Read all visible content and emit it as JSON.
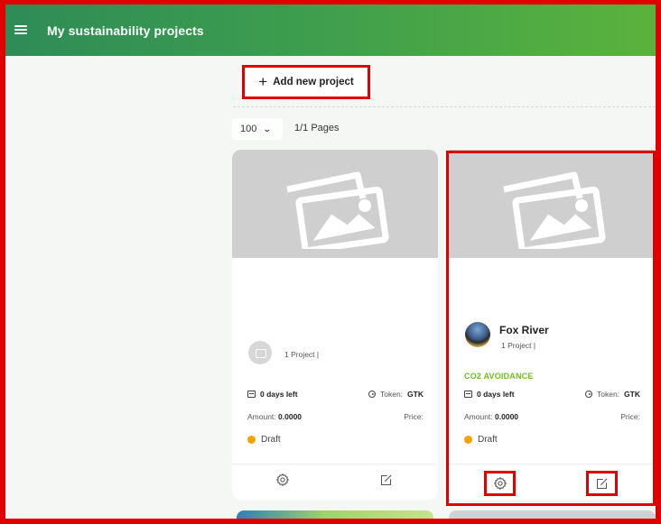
{
  "header": {
    "title": "My sustainability projects",
    "menu_icon": "hamburger-menu-icon"
  },
  "toolbar": {
    "add_project_label": "Add new project",
    "add_icon": "plus-icon"
  },
  "pagination": {
    "page_size": "100",
    "pages_label": "1/1 Pages"
  },
  "cards": [
    {
      "owner_name": "",
      "project_count": "1 Project |",
      "category": "",
      "days_left": "0 days left",
      "token_label": "Token:",
      "token_value": "GTK",
      "amount_label": "Amount:",
      "amount_value": "0.0000",
      "price_label": "Price:",
      "status": "Draft",
      "status_color": "#f5a300"
    },
    {
      "owner_name": "Fox River",
      "project_count": "1 Project |",
      "category": "CO2 AVOIDANCE",
      "days_left": "0 days left",
      "token_label": "Token:",
      "token_value": "GTK",
      "amount_label": "Amount:",
      "amount_value": "0.0000",
      "price_label": "Price:",
      "status": "Draft",
      "status_color": "#f5a300"
    }
  ],
  "colors": {
    "header_gradient_start": "#2e8b57",
    "header_gradient_end": "#5bb33c",
    "highlight": "#e00000",
    "category": "#6fbf1f",
    "status_draft": "#f5a300"
  }
}
